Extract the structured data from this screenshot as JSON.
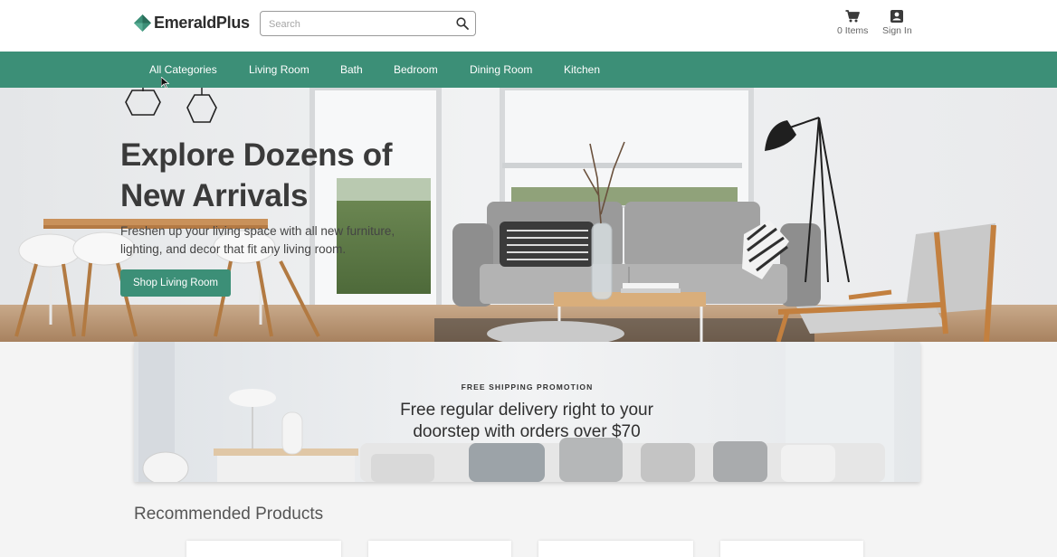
{
  "brand": {
    "name": "EmeraldPlus",
    "accent": "#3c8f77",
    "logo_icon": "diamond-logo-icon"
  },
  "search": {
    "placeholder": "Search",
    "icon": "search-icon"
  },
  "header_actions": {
    "cart_label": "0 Items",
    "cart_icon": "cart-icon",
    "signin_label": "Sign In",
    "signin_icon": "account-icon"
  },
  "nav": {
    "items": [
      "All Categories",
      "Living Room",
      "Bath",
      "Bedroom",
      "Dining Room",
      "Kitchen"
    ]
  },
  "hero": {
    "title_line1": "Explore Dozens of",
    "title_line2": "New Arrivals",
    "subtitle_line1": "Freshen up your living space with all new furniture,",
    "subtitle_line2": "lighting, and decor that fit any living room.",
    "cta": "Shop Living Room"
  },
  "promo": {
    "kicker": "FREE SHIPPING PROMOTION",
    "headline_line1": "Free regular delivery right to your",
    "headline_line2": "doorstep with orders over $70"
  },
  "recommended": {
    "title": "Recommended Products"
  }
}
